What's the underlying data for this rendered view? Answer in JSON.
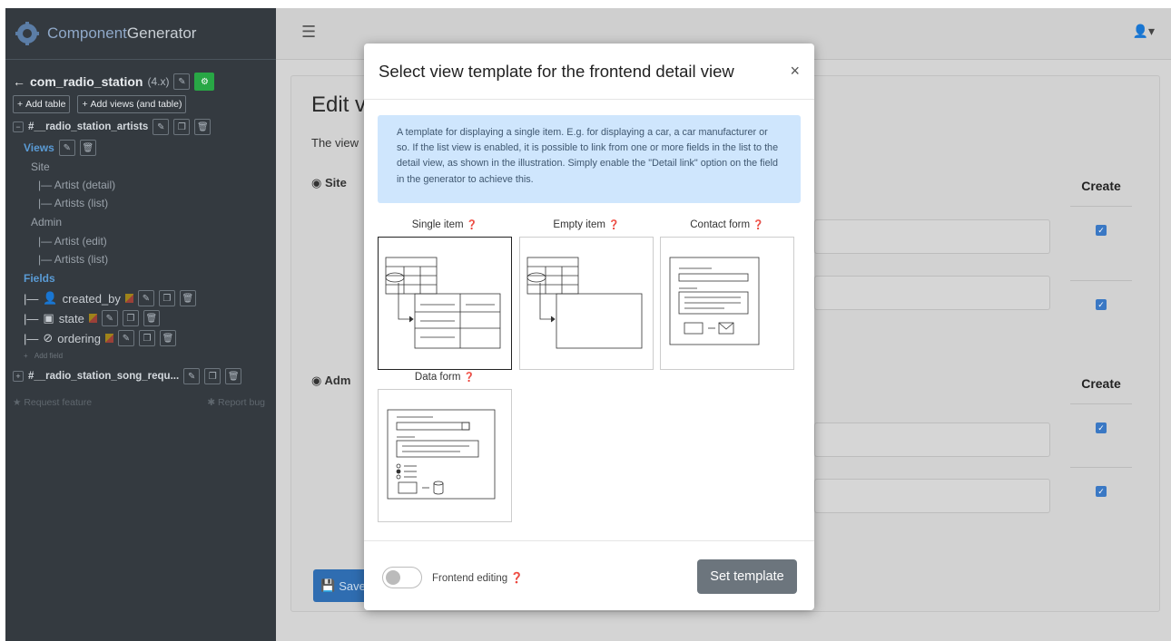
{
  "app": {
    "brand_prefix": "Component",
    "brand_suffix": "Generator"
  },
  "sidebar": {
    "component_name": "com_radio_station",
    "component_version": "(4.x)",
    "add_table_label": "Add table",
    "add_views_label": "Add views (and table)",
    "table1_name": "#__radio_station_artists",
    "views_label": "Views",
    "site_label": "Site",
    "site_items": [
      "|— Artist (detail)",
      "|— Artists (list)"
    ],
    "admin_label": "Admin",
    "admin_items": [
      "|— Artist (edit)",
      "|— Artists (list)"
    ],
    "fields_label": "Fields",
    "fields": [
      "created_by",
      "state",
      "ordering"
    ],
    "add_field_label": "Add field",
    "table2_name": "#__radio_station_song_requ...",
    "request_feature": "Request feature",
    "report_bug": "Report bug"
  },
  "main": {
    "title": "Edit vi",
    "description": "The view",
    "section_site": "Site",
    "section_admin": "Adm",
    "create_header": "Create",
    "save_label": "Save"
  },
  "modal": {
    "title": "Select view template for the frontend detail view",
    "close": "×",
    "info_text": "A template for displaying a single item. E.g. for displaying a car, a car manufacturer or so. If the list view is enabled, it is possible to link from one or more fields in the list to the detail view, as shown in the illustration. Simply enable the \"Detail link\" option on the field in the generator to achieve this.",
    "templates": [
      {
        "label": "Single item",
        "selected": true
      },
      {
        "label": "Empty item",
        "selected": false
      },
      {
        "label": "Contact form",
        "selected": false
      },
      {
        "label": "Data form",
        "selected": false
      }
    ],
    "frontend_editing_label": "Frontend editing",
    "frontend_editing_on": false,
    "set_template_label": "Set template"
  }
}
